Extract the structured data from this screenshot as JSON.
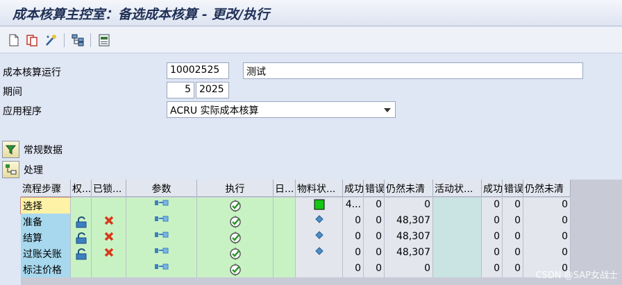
{
  "window": {
    "title": "成本核算主控室：备选成本核算 - 更改/执行"
  },
  "toolbar": {
    "buttons": [
      {
        "name": "new-doc-icon"
      },
      {
        "name": "copy-icon"
      },
      {
        "name": "wand-icon"
      },
      {
        "name": "hierarchy-icon"
      },
      {
        "name": "display-icon"
      }
    ]
  },
  "form": {
    "run_label": "成本核算运行",
    "run_id": "10002525",
    "run_desc": "测试",
    "period_label": "期间",
    "period": "5",
    "year": "2025",
    "app_label": "应用程序",
    "app_value": "ACRU 实际成本核算"
  },
  "sections": {
    "general": "常规数据",
    "process": "处理"
  },
  "table": {
    "headers": [
      "流程步骤",
      "权...",
      "已锁...",
      "参数",
      "执行",
      "日...",
      "物料状...",
      "成功",
      "错误",
      "仍然未清",
      "活动状...",
      "成功",
      "错误",
      "仍然未清"
    ],
    "rows": [
      {
        "step": "选择",
        "auth": false,
        "locked": false,
        "exec": true,
        "mat": "green",
        "s1": "4...",
        "e1": "0",
        "o1": "0",
        "s2": "0",
        "e2": "0",
        "o2": "0"
      },
      {
        "step": "准备",
        "auth": true,
        "locked": true,
        "exec": true,
        "mat": "diamond",
        "s1": "0",
        "e1": "0",
        "o1": "48,307",
        "s2": "0",
        "e2": "0",
        "o2": "0"
      },
      {
        "step": "结算",
        "auth": true,
        "locked": true,
        "exec": true,
        "mat": "diamond",
        "s1": "0",
        "e1": "0",
        "o1": "48,307",
        "s2": "0",
        "e2": "0",
        "o2": "0"
      },
      {
        "step": "过账关账",
        "auth": true,
        "locked": true,
        "exec": true,
        "mat": "diamond",
        "s1": "0",
        "e1": "0",
        "o1": "48,307",
        "s2": "0",
        "e2": "0",
        "o2": "0"
      },
      {
        "step": "标注价格",
        "auth": false,
        "locked": false,
        "exec": true,
        "mat": "",
        "s1": "0",
        "e1": "0",
        "o1": "0",
        "s2": "0",
        "e2": "0",
        "o2": "0"
      }
    ]
  },
  "watermark": "CSDN @SAP女战士",
  "colors": {
    "accent": "#1f2f55",
    "ok": "#13c713",
    "error": "#d63a1a"
  }
}
